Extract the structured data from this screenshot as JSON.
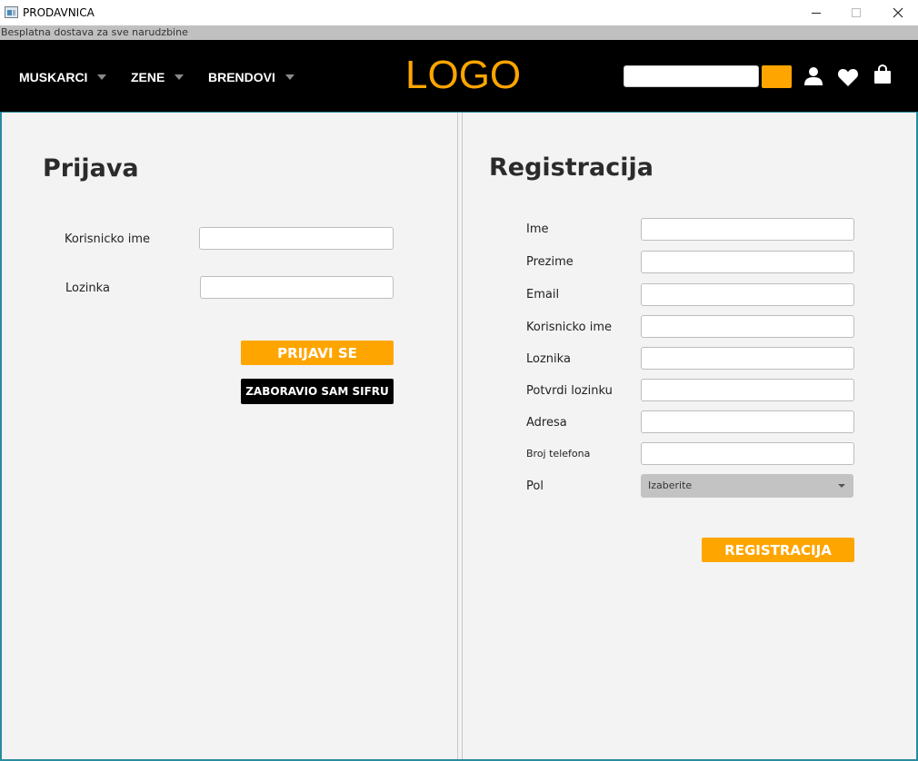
{
  "window": {
    "title": "PRODAVNICA",
    "controls": [
      "minimize",
      "maximize",
      "close"
    ]
  },
  "promo": {
    "text": "Besplatna dostava za sve narudzbine"
  },
  "nav": {
    "items": [
      {
        "label": "MUSKARCI"
      },
      {
        "label": "ZENE"
      },
      {
        "label": "BRENDOVI"
      }
    ],
    "logo": "LOGO",
    "search": {
      "value": "",
      "placeholder": ""
    },
    "icons": [
      "user-icon",
      "heart-icon",
      "shopping-bag-icon"
    ]
  },
  "login": {
    "title": "Prijava",
    "fields": [
      {
        "label": "Korisnicko ime",
        "value": ""
      },
      {
        "label": "Lozinka",
        "value": ""
      }
    ],
    "submit_label": "PRIJAVI SE",
    "forgot_label": "ZABORAVIO SAM SIFRU"
  },
  "register": {
    "title": "Registracija",
    "fields": [
      {
        "label": "Ime",
        "value": ""
      },
      {
        "label": "Prezime",
        "value": ""
      },
      {
        "label": "Email",
        "value": ""
      },
      {
        "label": "Korisnicko ime",
        "value": ""
      },
      {
        "label": "Loznika",
        "value": ""
      },
      {
        "label": "Potvrdi lozinku",
        "value": ""
      },
      {
        "label": "Adresa",
        "value": ""
      },
      {
        "label": "Broj telefona",
        "value": ""
      }
    ],
    "gender": {
      "label": "Pol",
      "selected": "Izaberite"
    },
    "submit_label": "REGISTRACIJA"
  },
  "colors": {
    "accent": "#ffa500",
    "navbar": "#000000",
    "panel": "#f3f3f3",
    "frame": "#2a8ca0"
  }
}
